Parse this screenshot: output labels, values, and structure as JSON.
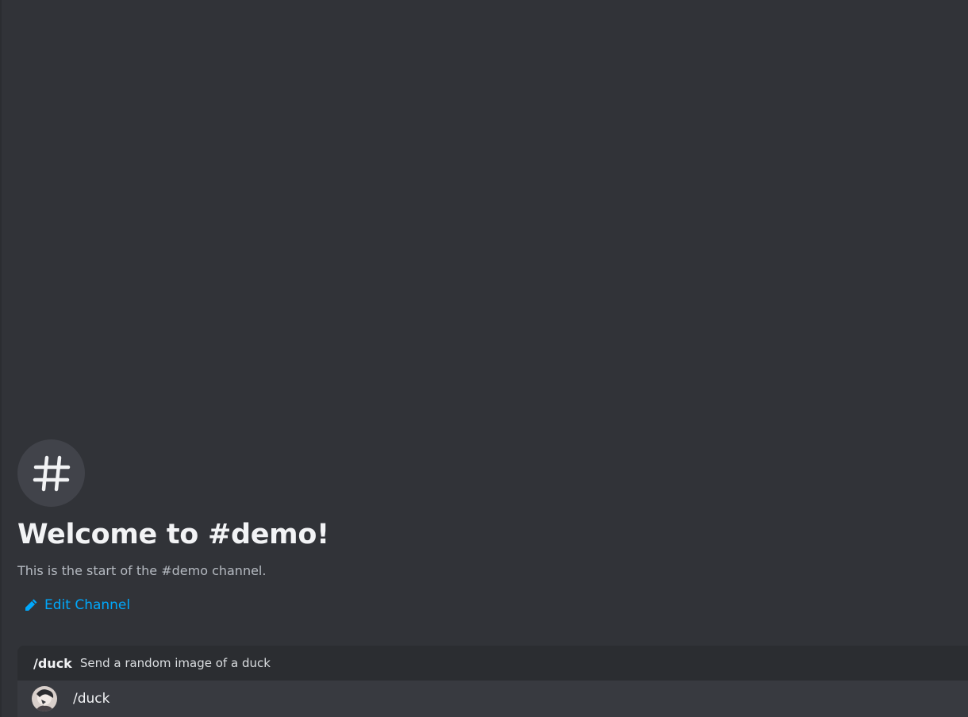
{
  "colors": {
    "background": "#313338",
    "channel_icon_bg": "#41434a",
    "title": "#f2f3f5",
    "subtitle": "#b5bac1",
    "link": "#00a8fc",
    "panel": "#383a40",
    "panel_header": "#2b2d31"
  },
  "channel_header": {
    "icon": "hash-icon",
    "title": "Welcome to #demo!",
    "subtitle": "This is the start of the #demo channel.",
    "edit_icon": "pencil-icon",
    "edit_label": "Edit Channel"
  },
  "command_autocomplete": {
    "command_name": "/duck",
    "command_description": "Send a random image of a duck",
    "option": {
      "avatar_icon": "bot-avatar",
      "label": "/duck"
    }
  }
}
